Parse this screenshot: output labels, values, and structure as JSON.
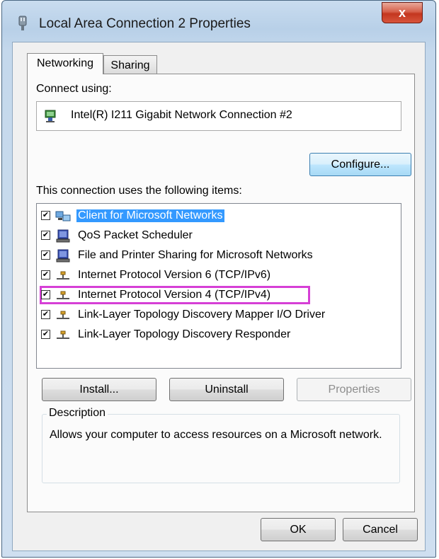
{
  "window": {
    "title": "Local Area Connection 2 Properties",
    "close_glyph": "x"
  },
  "tabs": [
    {
      "label": "Networking",
      "active": true
    },
    {
      "label": "Sharing",
      "active": false
    }
  ],
  "connect_using": {
    "label": "Connect using:",
    "adapter": "Intel(R) I211 Gigabit Network Connection #2",
    "adapter_icon": "network-adapter-icon"
  },
  "buttons": {
    "configure": "Configure...",
    "install": "Install...",
    "uninstall": "Uninstall",
    "properties": "Properties",
    "ok": "OK",
    "cancel": "Cancel"
  },
  "items_label": "This connection uses the following items:",
  "items": [
    {
      "label": "Client for Microsoft Networks",
      "checked": true,
      "selected": true,
      "icon": "client-network-icon"
    },
    {
      "label": "QoS Packet Scheduler",
      "checked": true,
      "selected": false,
      "icon": "service-computer-icon"
    },
    {
      "label": "File and Printer Sharing for Microsoft Networks",
      "checked": true,
      "selected": false,
      "icon": "service-computer-icon"
    },
    {
      "label": "Internet Protocol Version 6 (TCP/IPv6)",
      "checked": true,
      "selected": false,
      "icon": "protocol-icon"
    },
    {
      "label": "Internet Protocol Version 4 (TCP/IPv4)",
      "checked": true,
      "selected": false,
      "highlighted": true,
      "icon": "protocol-icon"
    },
    {
      "label": "Link-Layer Topology Discovery Mapper I/O Driver",
      "checked": true,
      "selected": false,
      "icon": "protocol-icon"
    },
    {
      "label": "Link-Layer Topology Discovery Responder",
      "checked": true,
      "selected": false,
      "icon": "protocol-icon"
    }
  ],
  "description": {
    "legend": "Description",
    "text": "Allows your computer to access resources on a Microsoft network."
  },
  "colors": {
    "selection": "#3399ff",
    "highlight_box": "#d63fd6",
    "close_button": "#c3361f"
  }
}
